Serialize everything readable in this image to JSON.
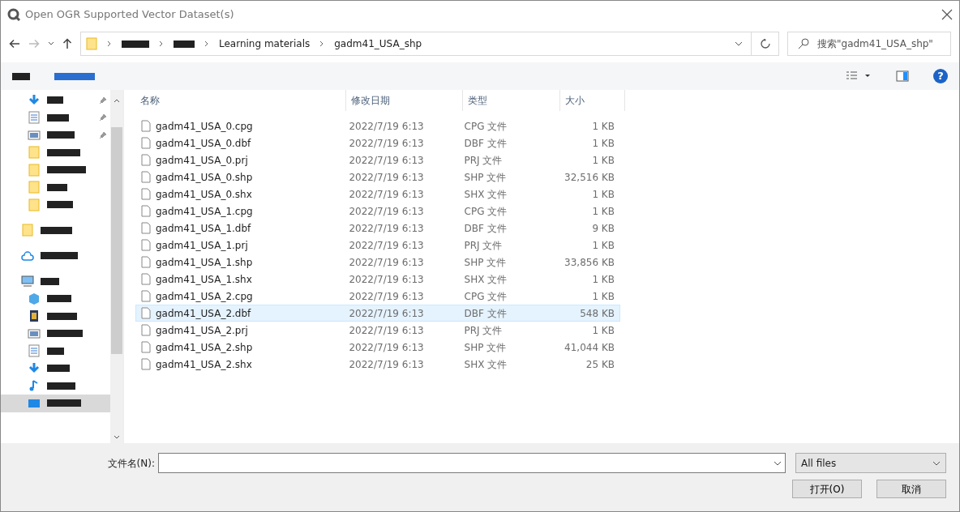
{
  "window": {
    "title": "Open OGR Supported Vector Dataset(s)"
  },
  "breadcrumb": [
    {
      "kind": "redacted"
    },
    {
      "kind": "redacted"
    },
    {
      "kind": "text",
      "label": "Learning materials"
    },
    {
      "kind": "text",
      "label": "gadm41_USA_shp"
    }
  ],
  "search": {
    "placeholder": "搜索\"gadm41_USA_shp\""
  },
  "toolbar": {
    "help_label": "?"
  },
  "sidebar": {
    "items": [
      {
        "kind": "download",
        "pinned": true,
        "selected": false,
        "indent": true
      },
      {
        "kind": "document",
        "pinned": true,
        "selected": false,
        "indent": true
      },
      {
        "kind": "pictures",
        "pinned": true,
        "selected": false,
        "indent": true
      },
      {
        "kind": "folder",
        "pinned": false,
        "selected": false,
        "indent": true
      },
      {
        "kind": "folder",
        "pinned": false,
        "selected": false,
        "indent": true
      },
      {
        "kind": "folder",
        "pinned": false,
        "selected": false,
        "indent": true
      },
      {
        "kind": "folder",
        "pinned": false,
        "selected": false,
        "indent": true
      },
      {
        "kind": "folder",
        "pinned": false,
        "selected": false,
        "indent": false
      },
      {
        "kind": "cloud",
        "pinned": false,
        "selected": false,
        "indent": false
      },
      {
        "kind": "computer",
        "pinned": false,
        "selected": false,
        "indent": false
      },
      {
        "kind": "cube",
        "pinned": false,
        "selected": false,
        "indent": true
      },
      {
        "kind": "video",
        "pinned": false,
        "selected": false,
        "indent": true
      },
      {
        "kind": "pictures",
        "pinned": false,
        "selected": false,
        "indent": true
      },
      {
        "kind": "document",
        "pinned": false,
        "selected": false,
        "indent": true
      },
      {
        "kind": "download",
        "pinned": false,
        "selected": false,
        "indent": true
      },
      {
        "kind": "music",
        "pinned": false,
        "selected": false,
        "indent": true
      },
      {
        "kind": "desktop",
        "pinned": false,
        "selected": true,
        "indent": true
      }
    ]
  },
  "table": {
    "columns": [
      "名称",
      "修改日期",
      "类型",
      "大小"
    ],
    "rows": [
      {
        "name": "gadm41_USA_0.cpg",
        "date": "2022/7/19 6:13",
        "type": "CPG 文件",
        "size": "1 KB",
        "selected": false
      },
      {
        "name": "gadm41_USA_0.dbf",
        "date": "2022/7/19 6:13",
        "type": "DBF 文件",
        "size": "1 KB",
        "selected": false
      },
      {
        "name": "gadm41_USA_0.prj",
        "date": "2022/7/19 6:13",
        "type": "PRJ 文件",
        "size": "1 KB",
        "selected": false
      },
      {
        "name": "gadm41_USA_0.shp",
        "date": "2022/7/19 6:13",
        "type": "SHP 文件",
        "size": "32,516 KB",
        "selected": false
      },
      {
        "name": "gadm41_USA_0.shx",
        "date": "2022/7/19 6:13",
        "type": "SHX 文件",
        "size": "1 KB",
        "selected": false
      },
      {
        "name": "gadm41_USA_1.cpg",
        "date": "2022/7/19 6:13",
        "type": "CPG 文件",
        "size": "1 KB",
        "selected": false
      },
      {
        "name": "gadm41_USA_1.dbf",
        "date": "2022/7/19 6:13",
        "type": "DBF 文件",
        "size": "9 KB",
        "selected": false
      },
      {
        "name": "gadm41_USA_1.prj",
        "date": "2022/7/19 6:13",
        "type": "PRJ 文件",
        "size": "1 KB",
        "selected": false
      },
      {
        "name": "gadm41_USA_1.shp",
        "date": "2022/7/19 6:13",
        "type": "SHP 文件",
        "size": "33,856 KB",
        "selected": false
      },
      {
        "name": "gadm41_USA_1.shx",
        "date": "2022/7/19 6:13",
        "type": "SHX 文件",
        "size": "1 KB",
        "selected": false
      },
      {
        "name": "gadm41_USA_2.cpg",
        "date": "2022/7/19 6:13",
        "type": "CPG 文件",
        "size": "1 KB",
        "selected": false
      },
      {
        "name": "gadm41_USA_2.dbf",
        "date": "2022/7/19 6:13",
        "type": "DBF 文件",
        "size": "548 KB",
        "selected": true
      },
      {
        "name": "gadm41_USA_2.prj",
        "date": "2022/7/19 6:13",
        "type": "PRJ 文件",
        "size": "1 KB",
        "selected": false
      },
      {
        "name": "gadm41_USA_2.shp",
        "date": "2022/7/19 6:13",
        "type": "SHP 文件",
        "size": "41,044 KB",
        "selected": false
      },
      {
        "name": "gadm41_USA_2.shx",
        "date": "2022/7/19 6:13",
        "type": "SHX 文件",
        "size": "25 KB",
        "selected": false
      }
    ]
  },
  "footer": {
    "filename_label": "文件名(N):",
    "filter": "All files",
    "buttons": [
      "打开(O)",
      "取消"
    ]
  }
}
